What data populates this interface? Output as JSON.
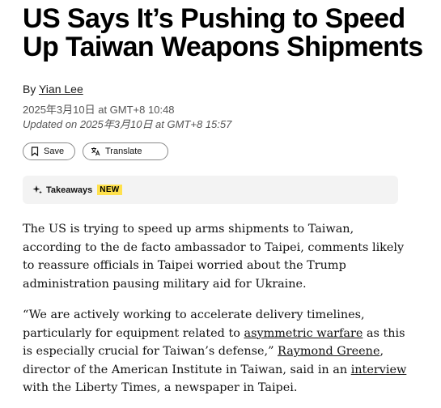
{
  "article": {
    "headline": "US Says It’s Pushing to Speed Up Taiwan Weapons Shipments",
    "byline_prefix": "By ",
    "author": "Yian Lee",
    "published": "2025年3月10日 at GMT+8 10:48",
    "updated": "Updated on 2025年3月10日 at GMT+8 15:57"
  },
  "actions": {
    "save_label": "Save",
    "translate_label": "Translate"
  },
  "takeaways": {
    "label": "Takeaways",
    "badge": "NEW"
  },
  "body": {
    "p1": "The US is trying to speed up arms shipments to Taiwan, according to the de facto ambassador to Taipei, comments likely to reassure officials in Taipei worried about the Trump administration pausing military aid for Ukraine.",
    "p2_a": "“We are actively working to accelerate delivery timelines, particularly for equipment related to ",
    "p2_link1": "asymmetric warfare",
    "p2_b": " as this is especially crucial for Taiwan’s defense,” ",
    "p2_link2": "Raymond Greene",
    "p2_c": ", director of the American Institute in Taiwan, said in an ",
    "p2_link3": "interview",
    "p2_d": " with the Liberty Times, a newspaper in Taipei."
  },
  "icons": {
    "save": "bookmark-icon",
    "translate": "translate-icon",
    "takeaways": "sparkle-icon"
  },
  "colors": {
    "badge_bg": "#ffe14d",
    "takeaways_bg": "#f3f3f3"
  }
}
